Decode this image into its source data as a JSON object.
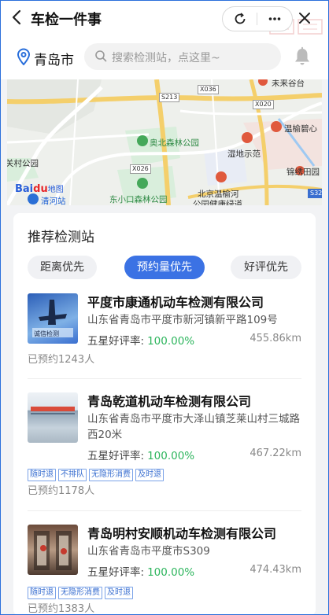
{
  "header": {
    "title": "车检一件事"
  },
  "search": {
    "city": "青岛市",
    "placeholder": "搜索检测站，点这里~"
  },
  "map": {
    "roads": [
      "S213",
      "X036",
      "X020",
      "X026",
      "S32"
    ],
    "places": [
      {
        "name": "奥北森林公园",
        "kind": "green"
      },
      {
        "name": "东小口森林公园",
        "kind": "green"
      },
      {
        "name": "关村公园",
        "kind": "plain"
      },
      {
        "name": "清河站",
        "kind": "blue"
      },
      {
        "name": "温榆碧心",
        "kind": "plain"
      },
      {
        "name": "湿地示范",
        "kind": "plain"
      },
      {
        "name": "锦绣田园",
        "kind": "plain"
      },
      {
        "name": "北京温榆河",
        "kind": "plain"
      },
      {
        "name": "公园健康绿道",
        "kind": "plain"
      },
      {
        "name": "未来谷台",
        "kind": "plain"
      }
    ],
    "logo": {
      "brand": "Bai",
      "paw": "du",
      "suffix": "地图"
    }
  },
  "section": {
    "title": "推荐检测站"
  },
  "tabs": [
    {
      "label": "距离优先",
      "active": false
    },
    {
      "label": "预约量优先",
      "active": true
    },
    {
      "label": "好评优先",
      "active": false
    }
  ],
  "rating_label": "五星好评率:",
  "stations": [
    {
      "name": "平度市康通机动车检测有限公司",
      "address": "山东省青岛市平度市新河镇新平路109号",
      "rating": "100.00%",
      "distance": "455.86km",
      "tags": [],
      "booked": "已预约1243人",
      "thumb_text": "诚信检测"
    },
    {
      "name": "青岛乾道机动车检测有限公司",
      "address": "山东省青岛市平度市大泽山镇芝莱山村三城路西20米",
      "rating": "100.00%",
      "distance": "467.22km",
      "tags": [
        "随时退",
        "不排队",
        "无隐形消费",
        "及时退"
      ],
      "booked": "已预约1178人"
    },
    {
      "name": "青岛明村安顺机动车检测有限公司",
      "address": "山东省青岛市平度市S309",
      "rating": "100.00%",
      "distance": "474.43km",
      "tags": [
        "随时退",
        "无隐形消费",
        "及时退"
      ],
      "booked": "已预约1383人"
    }
  ],
  "colors": {
    "accent": "#3b72e4",
    "rating": "#2db55d",
    "tag": "#3a6fd0"
  }
}
